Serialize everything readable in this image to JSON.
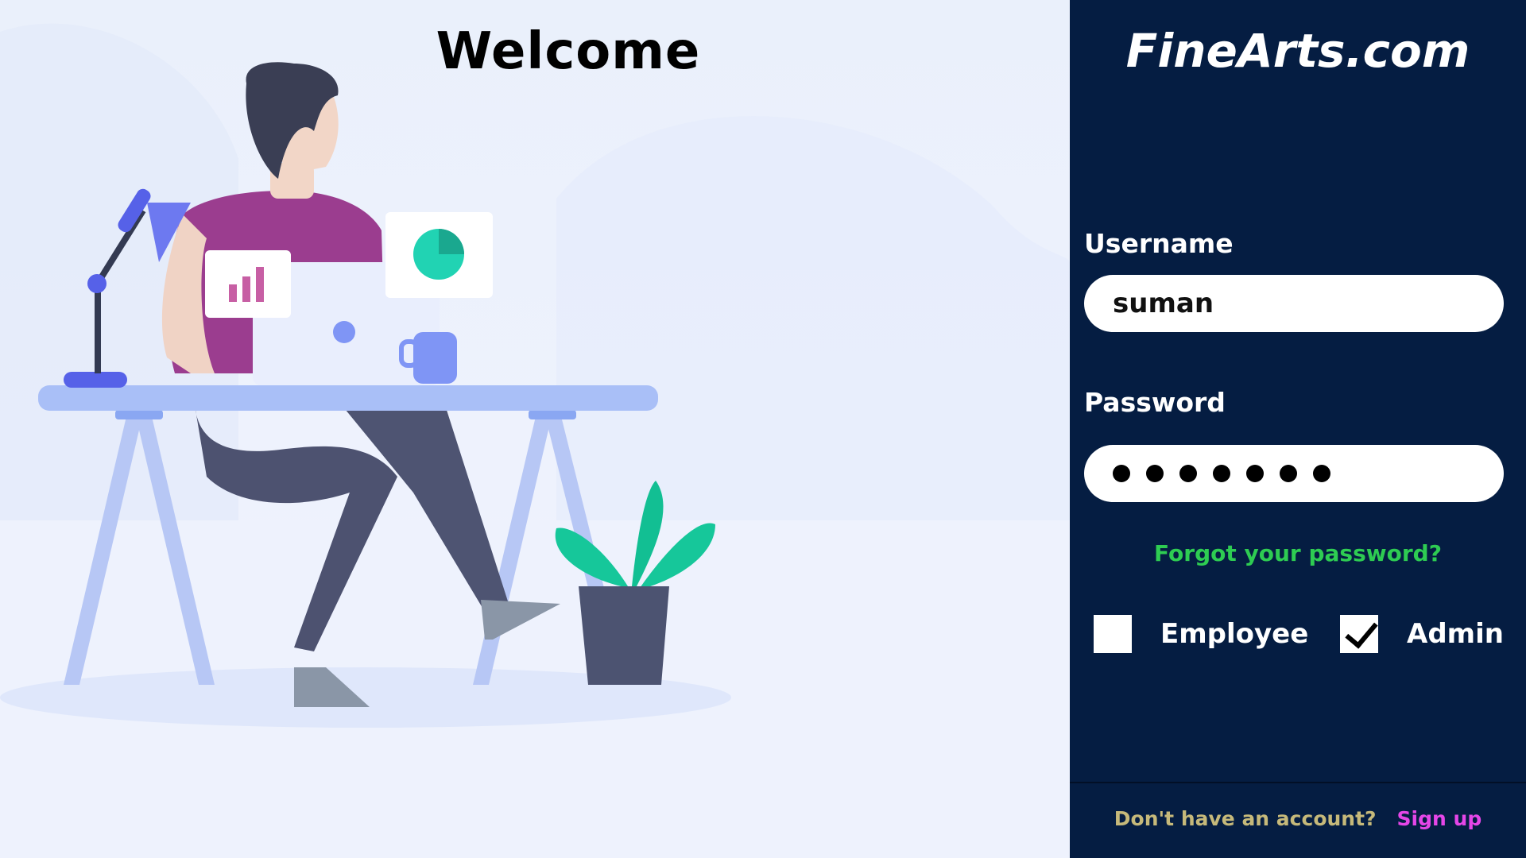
{
  "welcome": {
    "title": "Welcome"
  },
  "brand": {
    "name": "FineArts.com"
  },
  "login": {
    "username_label": "Username",
    "username_value": "suman",
    "password_label": "Password",
    "password_masked_length": 7,
    "forgot_link": "Forgot your password?",
    "roles": {
      "employee_label": "Employee",
      "employee_checked": false,
      "admin_label": "Admin",
      "admin_checked": true
    }
  },
  "footer": {
    "question": "Don't have an account?",
    "signup_link": "Sign up"
  },
  "icons": {
    "checkmark": "check-icon"
  },
  "colors": {
    "panel_bg": "#051d42",
    "forgot_link": "#2ecc52",
    "footer_question": "#c6b97a",
    "signup_link": "#e546e8"
  }
}
